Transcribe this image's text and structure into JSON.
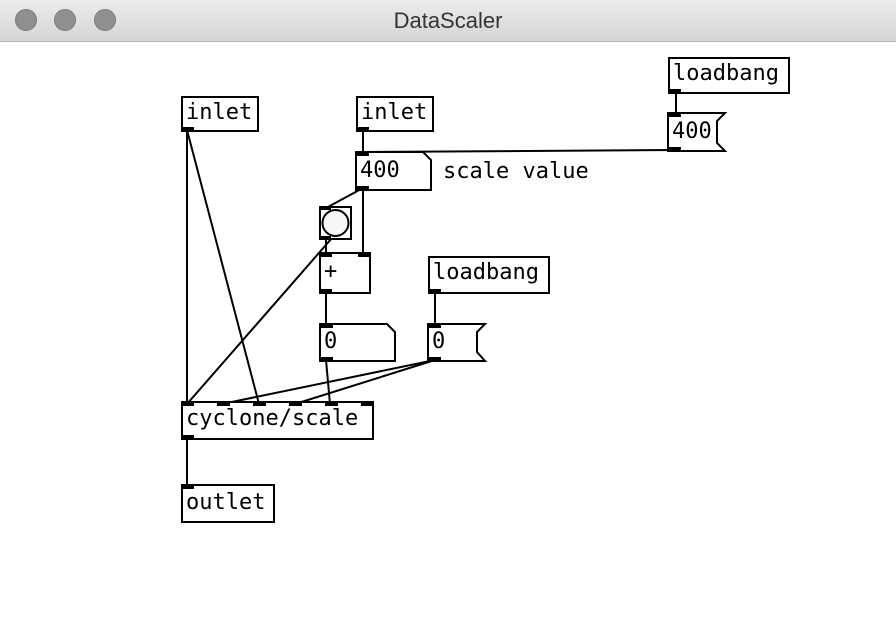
{
  "window": {
    "title": "DataScaler",
    "controls": [
      "close",
      "minimize",
      "zoom"
    ]
  },
  "patch": {
    "objects": {
      "inlet_left": "inlet",
      "inlet_right": "inlet",
      "loadbang_top": "loadbang",
      "msg_400": "400",
      "number_400": "400",
      "comment_scale": "scale value",
      "plus": "+",
      "loadbang_mid": "loadbang",
      "number_0": "0",
      "msg_0": "0",
      "scale": "cyclone/scale",
      "outlet": "outlet"
    }
  }
}
